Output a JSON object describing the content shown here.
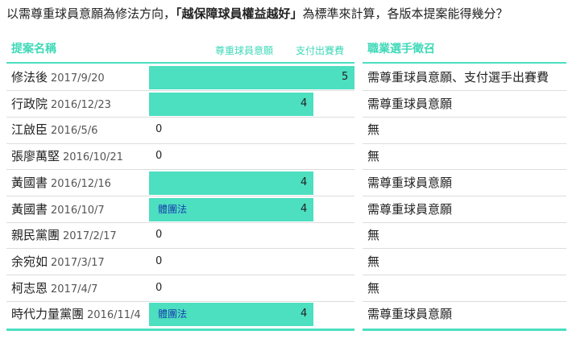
{
  "question": {
    "prefix": "以需尊重球員意願為修法方向，",
    "highlight": "「越保障球員權益越好」",
    "suffix": "為標準來計算，各版本提案能得幾分？"
  },
  "headers": {
    "proposal": "提案名稱",
    "respect_will": "尊重球員意願",
    "pay_fee": "支付出賽費",
    "draft": "職業選手徵召"
  },
  "colors": {
    "accent": "#4cdfc0",
    "text": "#222222",
    "note": "#1a3fae"
  },
  "chart_data": {
    "type": "bar",
    "xlim": [
      0,
      5
    ],
    "rows": [
      {
        "name": "修法後",
        "date": "2017/9/20",
        "value": 5,
        "value_label": "5",
        "note": "",
        "requirement": "需尊重球員意願、支付選手出賽費"
      },
      {
        "name": "行政院",
        "date": "2016/12/23",
        "value": 4,
        "value_label": "4",
        "note": "",
        "requirement": "需尊重球員意願"
      },
      {
        "name": "江啟臣",
        "date": "2016/5/6",
        "value": 0,
        "value_label": "0",
        "note": "",
        "requirement": "無"
      },
      {
        "name": "張廖萬堅",
        "date": "2016/10/21",
        "value": 0,
        "value_label": "0",
        "note": "",
        "requirement": "無"
      },
      {
        "name": "黃國書",
        "date": "2016/12/16",
        "value": 4,
        "value_label": "4",
        "note": "",
        "requirement": "需尊重球員意願"
      },
      {
        "name": "黃國書",
        "date": "2016/10/7",
        "value": 4,
        "value_label": "4",
        "note": "體團法",
        "requirement": "需尊重球員意願"
      },
      {
        "name": "親民黨團",
        "date": "2017/2/17",
        "value": 0,
        "value_label": "0",
        "note": "",
        "requirement": "無"
      },
      {
        "name": "余宛如",
        "date": "2017/3/17",
        "value": 0,
        "value_label": "0",
        "note": "",
        "requirement": "無"
      },
      {
        "name": "柯志恩",
        "date": "2017/4/7",
        "value": 0,
        "value_label": "0",
        "note": "",
        "requirement": "無"
      },
      {
        "name": "時代力量黨團",
        "date": "2016/11/4",
        "value": 4,
        "value_label": "4",
        "note": "體團法",
        "requirement": "需尊重球員意願"
      }
    ]
  }
}
